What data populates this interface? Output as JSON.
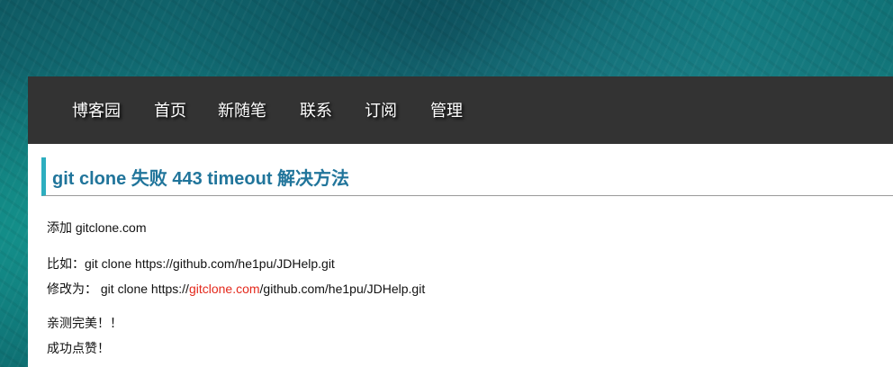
{
  "nav": {
    "items": [
      {
        "label": "博客园"
      },
      {
        "label": "首页"
      },
      {
        "label": "新随笔"
      },
      {
        "label": "联系"
      },
      {
        "label": "订阅"
      },
      {
        "label": "管理"
      }
    ]
  },
  "post": {
    "title": "git clone 失败 443 timeout 解决方法",
    "line1": "添加 gitclone.com",
    "line2": "比如：git clone https://github.com/he1pu/JDHelp.git",
    "line3_prefix": "修改为： git clone https://",
    "line3_highlight": "gitclone.com",
    "line3_suffix": "/github.com/he1pu/JDHelp.git",
    "line4": "亲测完美！！",
    "line5": "成功点赞！"
  },
  "colors": {
    "title": "#21759b",
    "title_bar": "#2daebf",
    "nav_bg": "#333333",
    "highlight": "#e4291c"
  }
}
